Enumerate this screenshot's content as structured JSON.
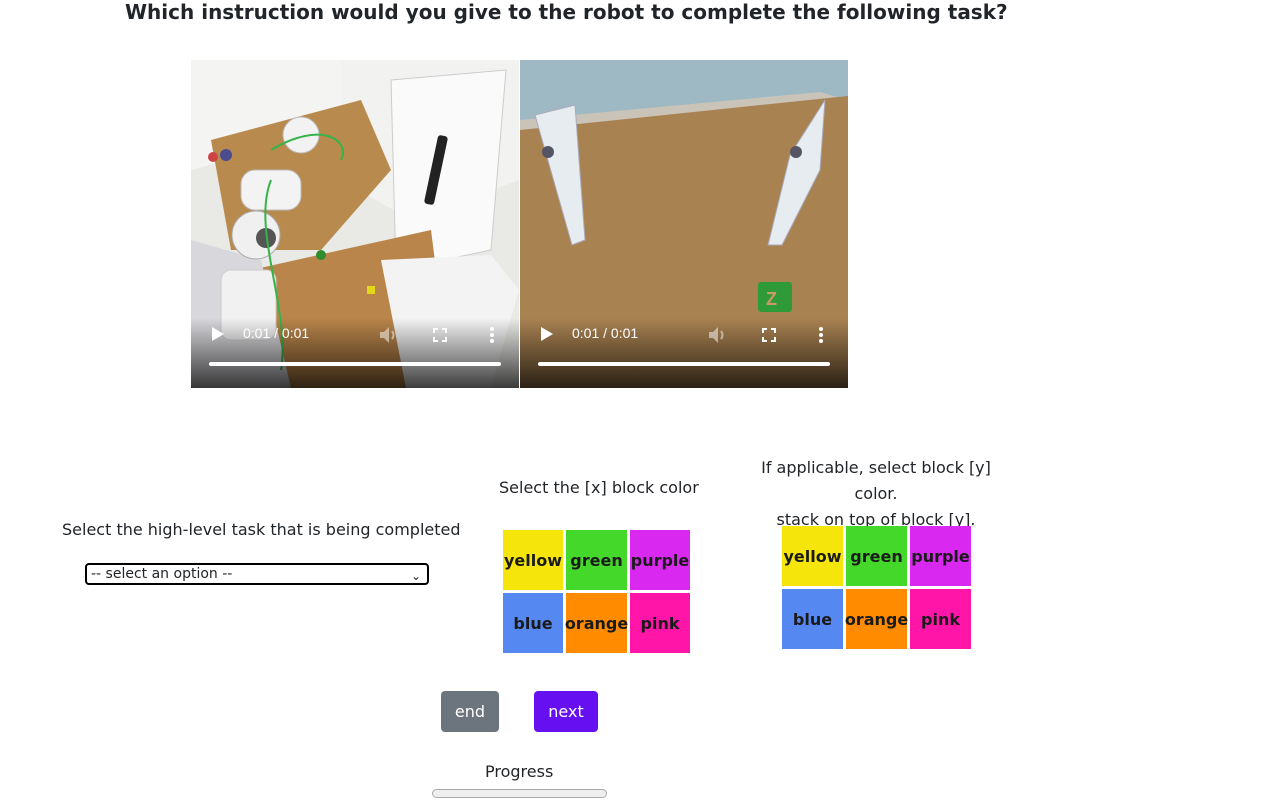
{
  "title": "Which instruction would you give to the robot to complete the following task?",
  "videos": [
    {
      "time": "0:01 / 0:01"
    },
    {
      "time": "0:01 / 0:01"
    }
  ],
  "task": {
    "label": "Select the high-level task that is being completed",
    "selected": "-- select an option --"
  },
  "x_block": {
    "label": "Select the [x] block color",
    "colors": [
      {
        "name": "yellow",
        "hex": "#f5e50a"
      },
      {
        "name": "green",
        "hex": "#43d82a"
      },
      {
        "name": "purple",
        "hex": "#d929f0"
      },
      {
        "name": "blue",
        "hex": "#5588f0"
      },
      {
        "name": "orange",
        "hex": "#ff8c00"
      },
      {
        "name": "pink",
        "hex": "#ff15a8"
      }
    ]
  },
  "y_block": {
    "label_line1": "If applicable, select block [y] color.",
    "label_line2": "stack on top of block [y].",
    "colors": [
      {
        "name": "yellow",
        "hex": "#f5e50a"
      },
      {
        "name": "green",
        "hex": "#43d82a"
      },
      {
        "name": "purple",
        "hex": "#d929f0"
      },
      {
        "name": "blue",
        "hex": "#5588f0"
      },
      {
        "name": "orange",
        "hex": "#ff8c00"
      },
      {
        "name": "pink",
        "hex": "#ff15a8"
      }
    ]
  },
  "buttons": {
    "end": "end",
    "next": "next"
  },
  "progress": {
    "label": "Progress",
    "value": 0
  }
}
